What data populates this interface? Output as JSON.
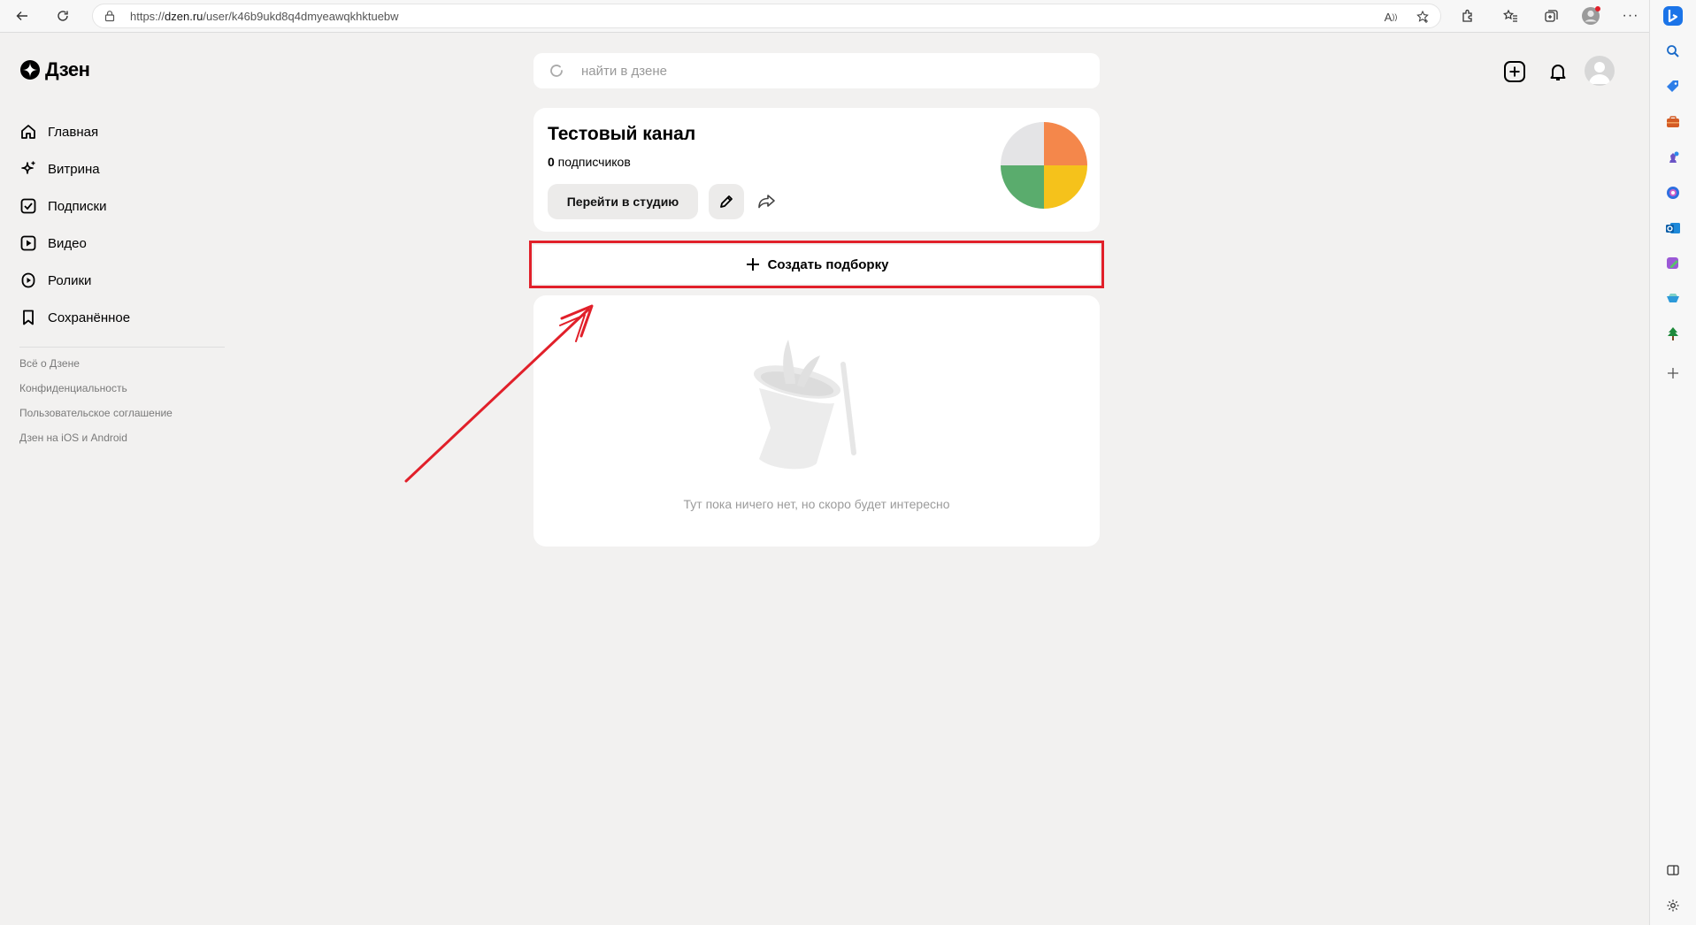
{
  "browser": {
    "url_prefix": "https://",
    "url_domain": "dzen.ru",
    "url_path": "/user/k46b9ukd8q4dmyeawqkhktuebw",
    "read_aloud_label": "A"
  },
  "site": {
    "logo_text": "Дзен"
  },
  "search": {
    "placeholder": "найти в дзене"
  },
  "sidebar": {
    "items": [
      {
        "label": "Главная",
        "icon": "home-icon"
      },
      {
        "label": "Витрина",
        "icon": "sparkle-icon"
      },
      {
        "label": "Подписки",
        "icon": "check-square-icon"
      },
      {
        "label": "Видео",
        "icon": "play-square-icon"
      },
      {
        "label": "Ролики",
        "icon": "play-circle-icon"
      },
      {
        "label": "Сохранённое",
        "icon": "bookmark-icon"
      }
    ],
    "footer_links": [
      "Всё о Дзене",
      "Конфиденциальность",
      "Пользовательское соглашение",
      "Дзен на iOS и Android"
    ]
  },
  "channel": {
    "name": "Тестовый канал",
    "subscribers_count": "0",
    "subscribers_label": " подписчиков",
    "studio_button": "Перейти в студию",
    "avatar_colors": [
      "#e4e4e6",
      "#f4874b",
      "#5aac6d",
      "#f5c21b"
    ]
  },
  "collection": {
    "create_label": "Создать подборку",
    "empty_message": "Тут пока ничего нет, но скоро будет интересно"
  },
  "colors": {
    "highlight": "#e1202a",
    "page_bg": "#f2f1f0",
    "edge_blue": "#1b74e8"
  }
}
